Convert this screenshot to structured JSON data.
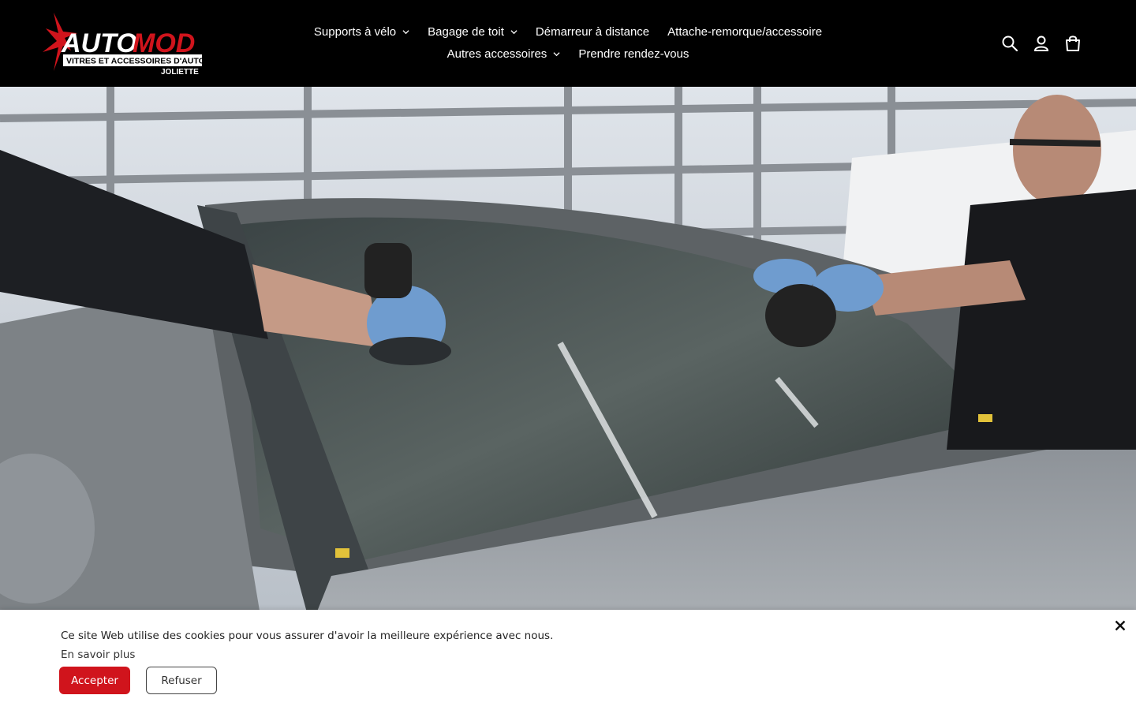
{
  "brand": {
    "logo_main_a": "AUTO",
    "logo_main_b": "MOD",
    "logo_tagline": "VITRES ET ACCESSOIRES D'AUTO",
    "logo_city": "JOLIETTE"
  },
  "nav": {
    "row1": [
      {
        "label": "Supports à vélo",
        "has_dropdown": true
      },
      {
        "label": "Bagage de toit",
        "has_dropdown": true
      },
      {
        "label": "Démarreur à distance",
        "has_dropdown": false
      },
      {
        "label": "Attache-remorque/accessoire",
        "has_dropdown": false
      }
    ],
    "row2": [
      {
        "label": "Autres accessoires",
        "has_dropdown": true
      },
      {
        "label": "Prendre rendez-vous",
        "has_dropdown": false
      }
    ]
  },
  "header_icons": [
    "search-icon",
    "account-icon",
    "cart-icon"
  ],
  "cookie": {
    "message": "Ce site Web utilise des cookies pour vous assurer d'avoir la meilleure expérience avec nous.",
    "learn_more": "En savoir plus",
    "accept": "Accepter",
    "refuse": "Refuser"
  },
  "colors": {
    "header_bg": "#000000",
    "brand_red": "#d0141c",
    "nav_text": "#ffffff"
  }
}
